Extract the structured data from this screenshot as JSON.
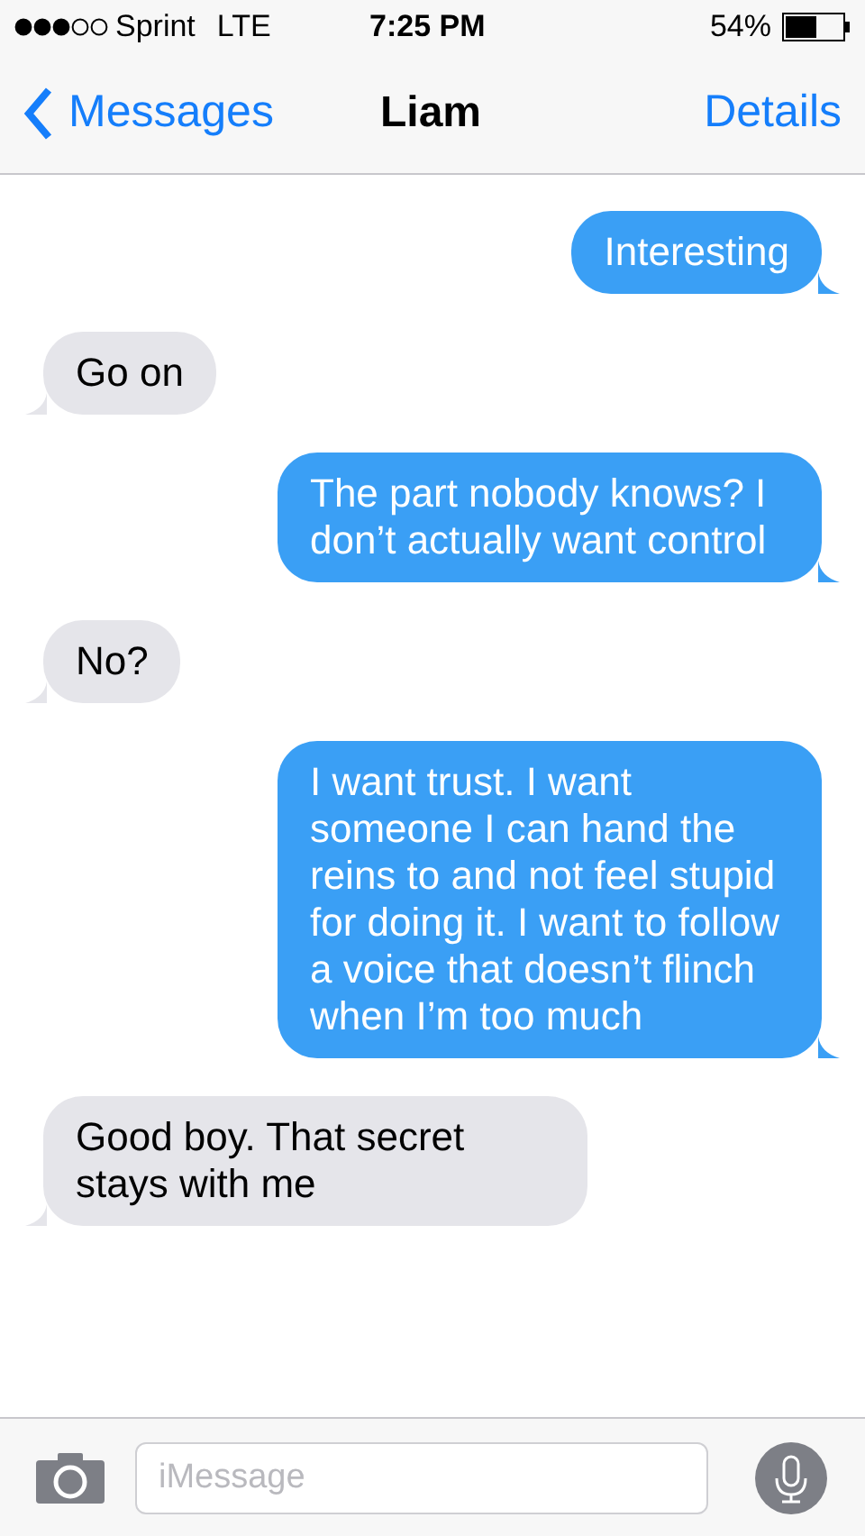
{
  "status_bar": {
    "carrier": "Sprint",
    "network": "LTE",
    "time": "7:25 PM",
    "battery": "54%"
  },
  "nav": {
    "back": "Messages",
    "title": "Liam",
    "action": "Details"
  },
  "messages": [
    {
      "kind": "sent",
      "text": "Interesting"
    },
    {
      "kind": "received",
      "text": "Go on"
    },
    {
      "kind": "sent",
      "text": "The part nobody knows? I don’t actually want control"
    },
    {
      "kind": "received",
      "text": "No?"
    },
    {
      "kind": "sent",
      "text": "I want trust. I want someone I can hand the reins to and not feel stupid for doing it. I want to follow a voice that doesn’t flinch when I’m too much"
    },
    {
      "kind": "received",
      "text": "Good boy. That secret stays with me"
    }
  ],
  "composer": {
    "placeholder": "iMessage"
  }
}
